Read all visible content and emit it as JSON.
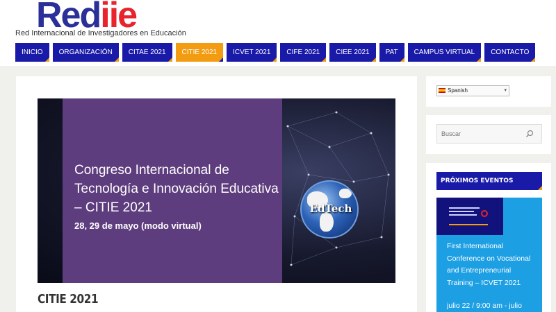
{
  "header": {
    "logo_part1": "Red",
    "logo_part2": "iie",
    "tagline": "Red Internacional de Investigadores en Educación"
  },
  "nav": {
    "items": [
      {
        "label": "INICIO"
      },
      {
        "label": "ORGANIZACIÓN"
      },
      {
        "label": "CITAE 2021"
      },
      {
        "label": "CITIE 2021",
        "active": true
      },
      {
        "label": "ICVET 2021"
      },
      {
        "label": "CIFE 2021"
      },
      {
        "label": "CIEE 2021"
      },
      {
        "label": "PAT"
      },
      {
        "label": "CAMPUS VIRTUAL"
      },
      {
        "label": "CONTACTO"
      }
    ],
    "colors": {
      "default": "#1a1aa8",
      "active": "#f39c12"
    }
  },
  "banner": {
    "title": "Congreso Internacional de Tecnología e Innovación Educativa – CITIE 2021",
    "date": "28, 29 de mayo (modo virtual)",
    "globe_label": "EdTech",
    "icon": "globe-icon"
  },
  "main": {
    "page_title": "CITIE 2021"
  },
  "sidebar": {
    "language": {
      "selected": "Spanish",
      "icon": "spain-flag-icon"
    },
    "search": {
      "placeholder": "Buscar",
      "icon": "search-icon"
    },
    "events": {
      "heading": "PRÓXIMOS EVENTOS",
      "items": [
        {
          "title": "First International Conference on Vocational and Entrepreneurial Training – ICVET 2021",
          "date": "julio 22 / 9:00 am - julio"
        }
      ]
    }
  }
}
